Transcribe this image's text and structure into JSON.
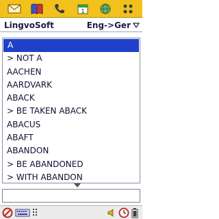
{
  "launcher": {
    "icons": [
      {
        "name": "messaging-icon"
      },
      {
        "name": "dictionary-book-icon"
      },
      {
        "name": "phone-handset-icon"
      },
      {
        "name": "calendar-icon"
      },
      {
        "name": "globe-icon"
      },
      {
        "name": "apps-grid-icon"
      }
    ],
    "colors": {
      "background": "#f3c11b"
    }
  },
  "header": {
    "app_title": "LingvoSoft",
    "language_direction": "Eng->Ger"
  },
  "word_list": {
    "items": [
      "A",
      "> NOT A",
      "AACHEN",
      "AARDVARK",
      "ABACK",
      "> BE TAKEN ABACK",
      "ABACUS",
      "ABAFT",
      "ABANDON",
      "> BE ABANDONED",
      "> WITH ABANDON"
    ],
    "selected_index": 0,
    "colors": {
      "selection": "#1f41c9"
    }
  },
  "search": {
    "value": ""
  },
  "status_bar": {
    "icons": [
      "no-entry-icon",
      "keyboard-icon",
      "input-mode-icon",
      "volume-icon",
      "clock-icon",
      "battery-icon"
    ]
  }
}
